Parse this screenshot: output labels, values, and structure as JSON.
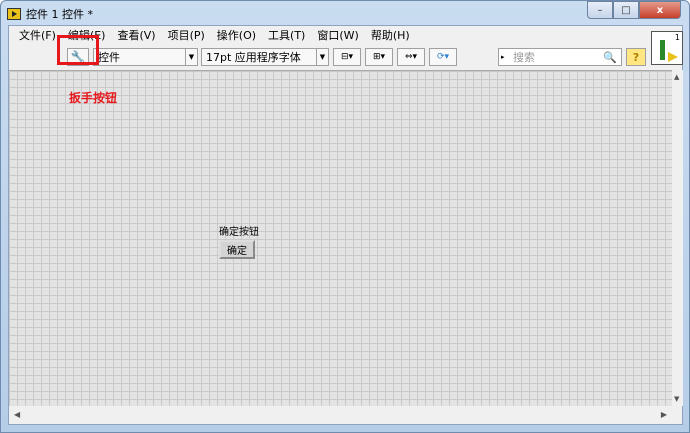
{
  "window": {
    "title": "控件 1 控件 *",
    "minimize": "–",
    "maximize": "□",
    "close": "x"
  },
  "menu": [
    "文件(F)",
    "编辑(E)",
    "查看(V)",
    "项目(P)",
    "操作(O)",
    "工具(T)",
    "窗口(W)",
    "帮助(H)"
  ],
  "toolbar": {
    "control_style": "控件",
    "font": "17pt 应用程序字体",
    "search_placeholder": "搜索",
    "help": "?"
  },
  "annotation": "扳手按钮",
  "panel": {
    "button_label": "确定按钮",
    "button_text": "确定"
  },
  "icon": {
    "number": "1"
  }
}
